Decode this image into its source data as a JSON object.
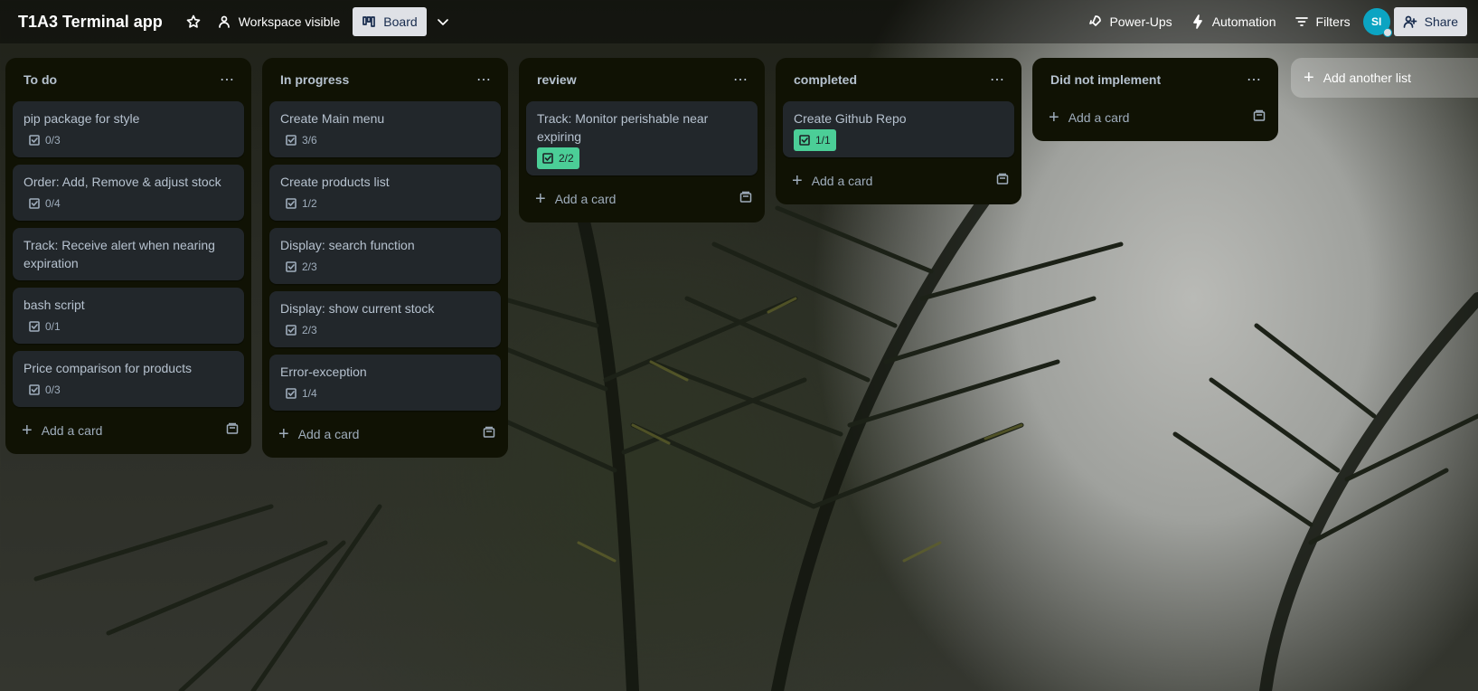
{
  "header": {
    "board_title": "T1A3 Terminal app",
    "visibility": "Workspace visible",
    "view": "Board",
    "power_ups": "Power-Ups",
    "automation": "Automation",
    "filters": "Filters",
    "avatar_initials": "SI",
    "share": "Share"
  },
  "icons": {
    "star": "star-icon",
    "visibility": "people-icon",
    "board": "board-view-icon",
    "chevron": "chevron-down-icon",
    "power_ups": "rocket-icon",
    "automation": "lightning-icon",
    "filters": "filter-icon",
    "share": "add-person-icon",
    "checklist": "checklist-icon",
    "template": "card-template-icon"
  },
  "colors": {
    "list_bg": "#101204",
    "card_bg": "#22272b",
    "complete_badge": "#4bce97",
    "avatar": "#0ba4c2"
  },
  "lists": [
    {
      "title": "To do",
      "cards": [
        {
          "title": "pip package for style",
          "checklist": "0/3"
        },
        {
          "title": "Order: Add, Remove & adjust stock",
          "checklist": "0/4"
        },
        {
          "title": "Track: Receive alert when nearing expiration"
        },
        {
          "title": "bash script",
          "checklist": "0/1"
        },
        {
          "title": "Price comparison for products",
          "checklist": "0/3"
        }
      ],
      "add_card": "Add a card"
    },
    {
      "title": "In progress",
      "cards": [
        {
          "title": "Create Main menu",
          "checklist": "3/6"
        },
        {
          "title": "Create products list",
          "checklist": "1/2"
        },
        {
          "title": "Display: search function",
          "checklist": "2/3"
        },
        {
          "title": "Display: show current stock",
          "checklist": "2/3"
        },
        {
          "title": "Error-exception",
          "checklist": "1/4"
        }
      ],
      "add_card": "Add a card"
    },
    {
      "title": "review",
      "cards": [
        {
          "title": "Track: Monitor perishable near expiring",
          "checklist": "2/2"
        }
      ],
      "add_card": "Add a card"
    },
    {
      "title": "completed",
      "cards": [
        {
          "title": "Create Github Repo",
          "checklist": "1/1"
        }
      ],
      "add_card": "Add a card"
    },
    {
      "title": "Did not implement",
      "cards": [],
      "add_card": "Add a card"
    }
  ],
  "add_list": "Add another list"
}
